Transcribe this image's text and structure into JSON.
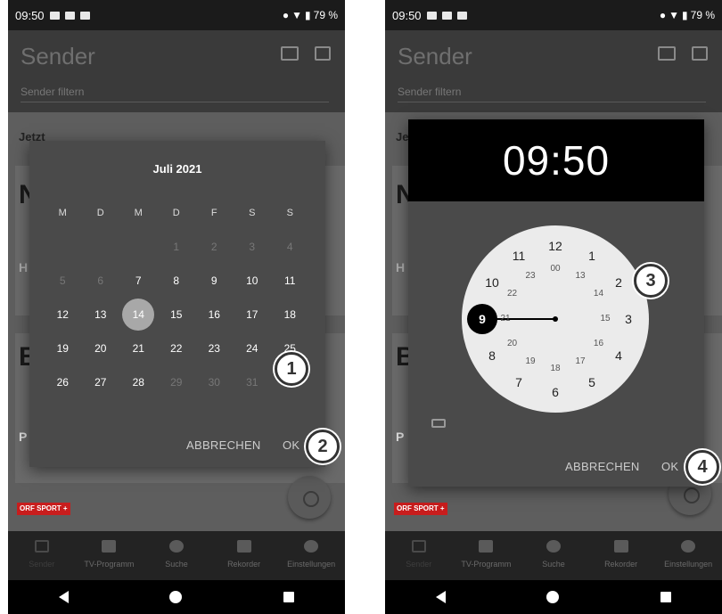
{
  "status": {
    "time_left": "09:50",
    "time_right": "09:50",
    "battery": "79 %"
  },
  "app": {
    "title": "Sender",
    "filter_placeholder": "Sender filtern",
    "now_label_left": "Jetzt",
    "now_label_right": "Je"
  },
  "nav": [
    {
      "label": "Sender"
    },
    {
      "label": "TV-Programm"
    },
    {
      "label": "Suche"
    },
    {
      "label": "Rekorder"
    },
    {
      "label": "Einstellungen"
    }
  ],
  "date_dialog": {
    "month": "Juli 2021",
    "weekdays": [
      "M",
      "D",
      "M",
      "D",
      "F",
      "S",
      "S"
    ],
    "weeks": [
      [
        "",
        "",
        "",
        "1",
        "2",
        "3",
        "4"
      ],
      [
        "5",
        "6",
        "7",
        "8",
        "9",
        "10",
        "11"
      ],
      [
        "12",
        "13",
        "14",
        "15",
        "16",
        "17",
        "18"
      ],
      [
        "19",
        "20",
        "21",
        "22",
        "23",
        "24",
        "25"
      ],
      [
        "26",
        "27",
        "28",
        "29",
        "30",
        "31",
        ""
      ]
    ],
    "selected_day": "14",
    "cancel_label": "ABBRECHEN",
    "ok_label": "OK"
  },
  "time_dialog": {
    "time": "09:50",
    "outer_hours": [
      "12",
      "1",
      "2",
      "3",
      "4",
      "5",
      "6",
      "7",
      "8",
      "9",
      "10",
      "11"
    ],
    "inner_hours": [
      "00",
      "13",
      "14",
      "15",
      "16",
      "17",
      "18",
      "19",
      "20",
      "21",
      "22",
      "23"
    ],
    "selected_hour": "9",
    "cancel_label": "ABBRECHEN",
    "ok_label": "OK"
  },
  "markers": {
    "m1": "1",
    "m2": "2",
    "m3": "3",
    "m4": "4"
  },
  "card_letters": {
    "c1": "N",
    "c2": "H",
    "c3": "B",
    "c4": "P"
  },
  "orf_label": "ORF SPORT +"
}
